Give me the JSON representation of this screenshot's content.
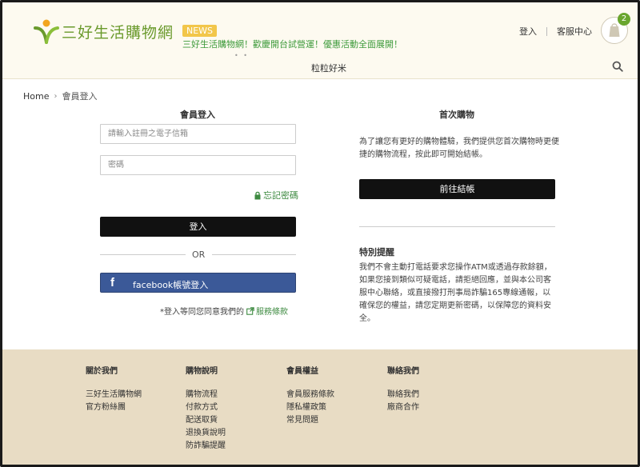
{
  "header": {
    "logo_text": "三好生活購物網",
    "news_badge": "NEWS",
    "news_text": "三好生活購物網！歡慶開台試營運！優惠活動全面展開！",
    "news_dots": "• •",
    "login_label": "登入",
    "service_label": "客服中心",
    "cart_count": "2",
    "nav_item": "粒粒好米"
  },
  "breadcrumb": {
    "home": "Home",
    "current": "會員登入"
  },
  "login": {
    "title": "會員登入",
    "email_placeholder": "請輸入註冊之電子信箱",
    "password_placeholder": "密碼",
    "forgot_label": "忘記密碼",
    "submit_label": "登入",
    "or_label": "OR",
    "facebook_icon": "f",
    "facebook_label": "facebook帳號登入",
    "terms_prefix": "*登入等同您同意我們的",
    "terms_link": "服務條款"
  },
  "first_purchase": {
    "title": "首次購物",
    "desc": "為了讓您有更好的購物體驗，我們提供您首次購物時更便捷的購物流程，按此即可開始結帳。",
    "checkout_label": "前往結帳"
  },
  "notice": {
    "title": "特別提醒",
    "body": "我們不會主動打電話要求您操作ATM或透過存款餘額，如果您接到類似可疑電話，請拒絕回應，並與本公司客服中心聯絡，或直接撥打刑事局詐騙165專線通報，以確保您的權益，請您定期更新密碼，以保障您的資料安全。"
  },
  "footer": {
    "columns": [
      {
        "heading": "關於我們",
        "items": [
          "三好生活購物網",
          "官方粉絲團"
        ]
      },
      {
        "heading": "購物說明",
        "items": [
          "購物流程",
          "付款方式",
          "配送取貨",
          "退換貨說明",
          "防詐騙提醒"
        ]
      },
      {
        "heading": "會員權益",
        "items": [
          "會員服務條款",
          "隱私權政策",
          "常見問題"
        ]
      },
      {
        "heading": "聯絡我們",
        "items": [
          "聯絡我們",
          "廠商合作"
        ]
      }
    ]
  },
  "colors": {
    "brand_green": "#6a9a2c",
    "link_green": "#3d8a40",
    "news_yellow": "#f2c64a",
    "facebook_blue": "#3b5998",
    "footer_bg": "#e8dcc4",
    "header_bg": "#fdfaf0"
  }
}
